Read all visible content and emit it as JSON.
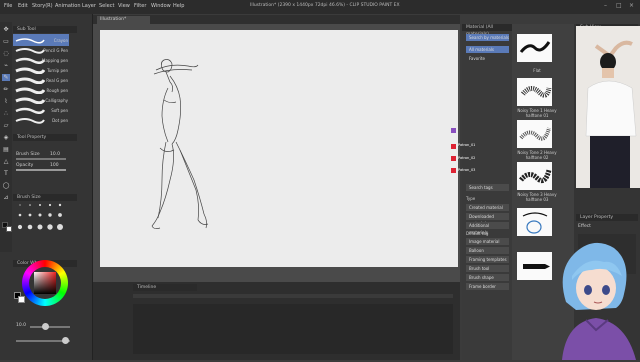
{
  "window": {
    "title": "Illustration* (2390 x 1440px 72dpi 46.6%) - CLIP STUDIO PAINT EX"
  },
  "menu": [
    "File",
    "Edit",
    "Story(R)",
    "Animation",
    "Layer",
    "Select",
    "View",
    "Filter",
    "Window",
    "Help"
  ],
  "canvas_tab": "Illustration*",
  "left": {
    "sub_tool_header": "Sub Tool",
    "brushes": [
      {
        "label": "Crayon"
      },
      {
        "label": "Pencil G Pen"
      },
      {
        "label": "Mapping pen"
      },
      {
        "label": "Turnip pen"
      },
      {
        "label": "Real G pen"
      },
      {
        "label": "Rough pen"
      },
      {
        "label": "Calligraphy"
      },
      {
        "label": "Soft pen"
      },
      {
        "label": "Dot pen"
      }
    ],
    "tool_property_header": "Tool Property",
    "brush_size_label": "Brush Size",
    "brush_size_value": "10.0",
    "opacity_label": "Opacity",
    "opacity_value": "100",
    "brush_size_panel_header": "Brush Size",
    "color_wheel_header": "Color Wheel",
    "sub_value": "10.0",
    "tool_icons": [
      "move-icon",
      "select-icon",
      "lasso-icon",
      "eyedropper-icon",
      "pen-icon",
      "pencil-icon",
      "brush-icon",
      "airbrush-icon",
      "eraser-icon",
      "fill-icon",
      "gradient-icon",
      "figure-icon",
      "text-icon",
      "balloon-icon",
      "ruler-icon"
    ]
  },
  "timeline": {
    "header": "Timeline"
  },
  "materials": {
    "header": "Material (All materials)",
    "search_placeholder": "Search by materials",
    "tree": [
      "All materials",
      "Favorite"
    ],
    "search_tag_placeholder": "Search tags",
    "type_label": "Type",
    "type_tags": [
      "Created material",
      "Downloaded material",
      "Additional materials"
    ],
    "default_tag_label": "Default tag",
    "default_tags": [
      "Image material",
      "Balloon",
      "Framing templates",
      "Brush tool",
      "Brush shape",
      "Frame border"
    ],
    "cards": [
      {
        "label": "Flat"
      },
      {
        "label": "Noisy Tone 1 Heavy halftone 01"
      },
      {
        "label": "Noisy Tone 2 Heavy halftone 02"
      },
      {
        "label": "Noisy Tone 3 Heavy halftone 03"
      },
      {
        "label": ""
      },
      {
        "label": ""
      }
    ]
  },
  "right": {
    "sub_view_header": "Sub View",
    "layer_property_header": "Layer Property",
    "effect_label": "Effect"
  },
  "overlay_labels": [
    "Patron_01",
    "Patron_02",
    "Patron_03"
  ],
  "colors": {
    "accent": "#5a7ab8",
    "canvas": "#ececec",
    "panel": "#343434"
  }
}
